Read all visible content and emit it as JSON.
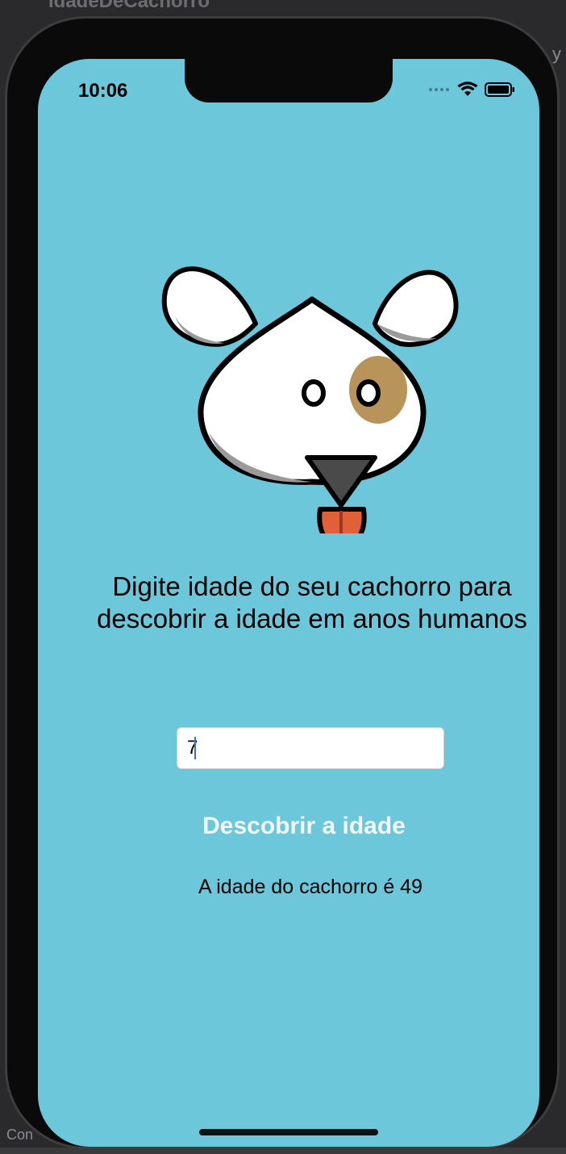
{
  "ide": {
    "window_title": "IdadeDeCachorro",
    "right_fragment": "y",
    "bottom_fragment": "Con"
  },
  "status_bar": {
    "time": "10:06"
  },
  "app": {
    "prompt": "Digite  idade do seu cachorro para descobrir a idade em anos humanos",
    "input_value": "7",
    "button_label": "Descobrir a idade",
    "result_text": "A idade do cachorro é 49"
  },
  "colors": {
    "background": "#6bc7d9",
    "button_text": "#f2f7fa",
    "dog_spot": "#b8945a",
    "dog_tongue": "#e0603a",
    "caret": "#3c6be0"
  }
}
